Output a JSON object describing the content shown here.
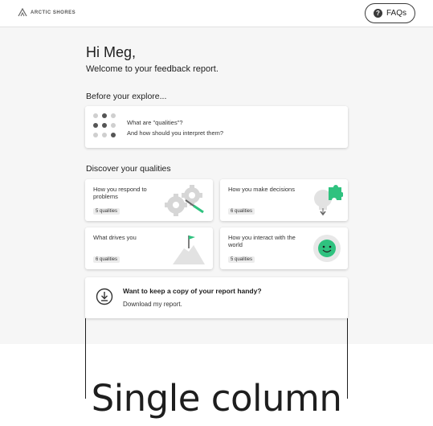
{
  "header": {
    "logo_text": "ARCTIC SHORES",
    "faq_label": "FAQs",
    "faq_icon": "question-circle-icon"
  },
  "main": {
    "greeting": "Hi Meg,",
    "welcome": "Welcome to your feedback report.",
    "explore_heading": "Before your explore...",
    "explore_card": {
      "line1": "What are \"qualities\"?",
      "line2": "And how should you interpret them?"
    },
    "discover_heading": "Discover your qualities",
    "qualities": [
      {
        "title": "How you respond to problems",
        "badge": "5 qualities",
        "icon": "gears-icon"
      },
      {
        "title": "How you make decisions",
        "badge": "6 qualities",
        "icon": "puzzle-bulb-icon"
      },
      {
        "title": "What drives you",
        "badge": "6 qualities",
        "icon": "mountain-flag-icon"
      },
      {
        "title": "How you interact with the world",
        "badge": "5 qualities",
        "icon": "smiley-icon"
      }
    ],
    "download": {
      "title": "Want to keep a copy of your report handy?",
      "subtitle": "Download my report.",
      "icon": "download-icon"
    }
  },
  "caption": "Single column",
  "colors": {
    "accent_green": "#2fc27f",
    "background": "#f6f6f6",
    "text": "#1e1e1e"
  }
}
